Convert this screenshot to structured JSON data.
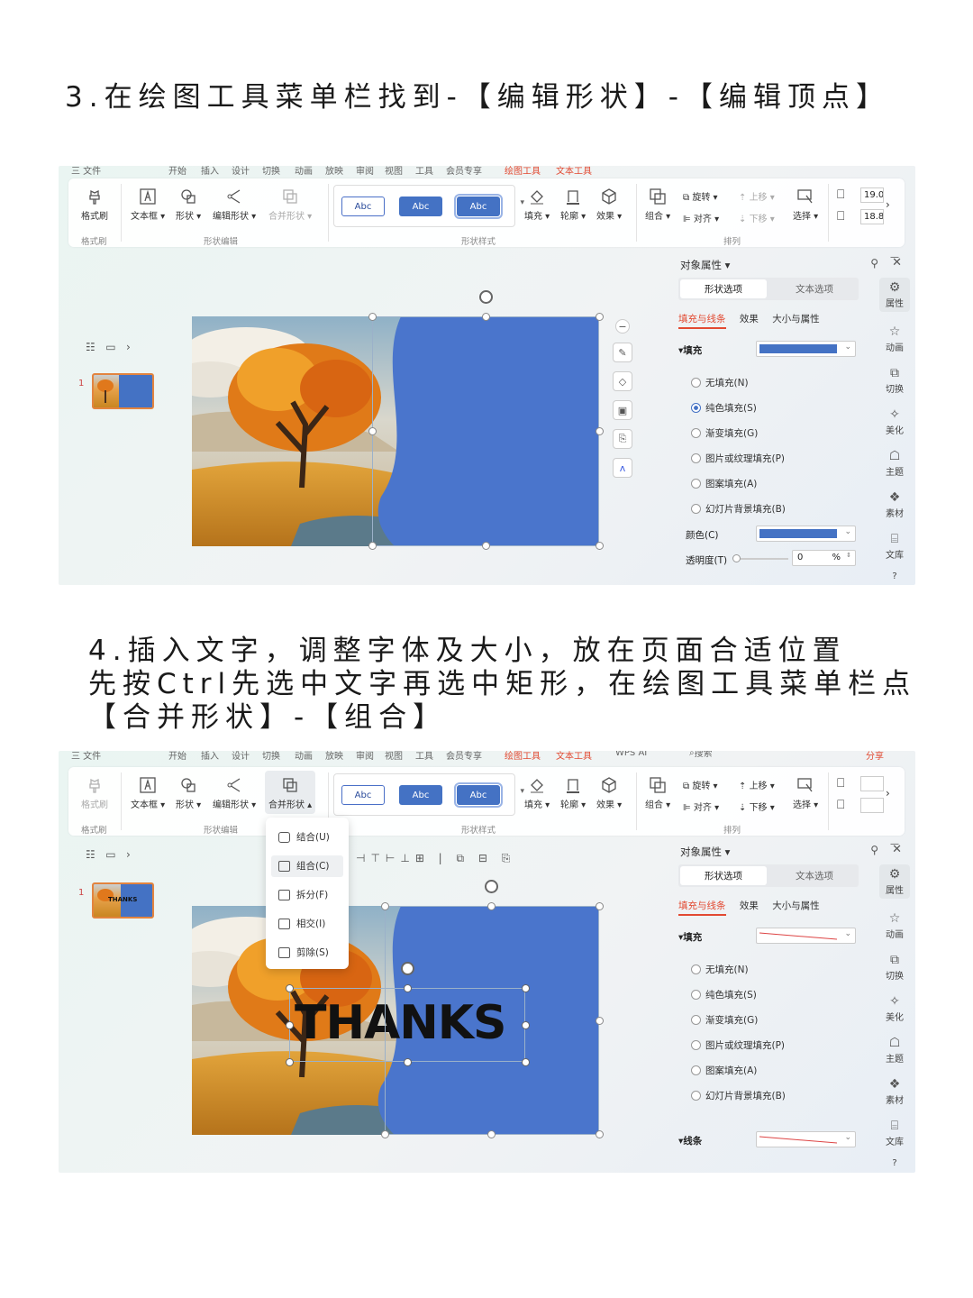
{
  "step3": {
    "heading": "3.在绘图工具菜单栏找到-【编辑形状】-【编辑顶点】"
  },
  "step4": {
    "heading_line1": "4.插入文字，调整字体及大小，放在页面合适位置",
    "heading_line2": "先按Ctrl先选中文字再选中矩形，在绘图工具菜单栏点",
    "heading_line3": "【合并形状】-【组合】"
  },
  "menubar": {
    "items": [
      "开始",
      "插入",
      "设计",
      "切换",
      "动画",
      "放映",
      "审阅",
      "视图",
      "工具",
      "会员专享",
      "绘图工具",
      "文本工具",
      "WPS AI"
    ],
    "active": "绘图工具",
    "search": "搜索",
    "share": "分享",
    "file": "三 文件"
  },
  "ribbon": {
    "format_painter": "格式刷",
    "textbox": "文本框",
    "shape": "形状",
    "edit_shape": "编辑形状",
    "merge_shape": "合并形状",
    "group_format": "格式刷",
    "group_edit": "形状编辑",
    "style_btn": "Abc",
    "fill": "填充",
    "outline": "轮廓",
    "effect": "效果",
    "group_style": "形状样式",
    "combine": "组合",
    "rotate": "旋转",
    "align": "对齐",
    "up": "上移",
    "down": "下移",
    "select": "选择",
    "group_arrange": "排列",
    "width": "19.0",
    "height": "18.8"
  },
  "panel": {
    "title": "对象属性",
    "tab_shape": "形状选项",
    "tab_text": "文本选项",
    "sub_fill": "填充与线条",
    "sub_effect": "效果",
    "sub_size": "大小与属性",
    "fill_section": "填充",
    "opt_none": "无填充(N)",
    "opt_solid": "纯色填充(S)",
    "opt_gradient": "渐变填充(G)",
    "opt_picture": "图片或纹理填充(P)",
    "opt_pattern": "图案填充(A)",
    "opt_slide": "幻灯片背景填充(B)",
    "color_label": "颜色(C)",
    "transparency_label": "透明度(T)",
    "transparency_value": "0",
    "transparency_unit": "%",
    "line_section": "线条",
    "fill_color": "#4472c4"
  },
  "rightbar": [
    "属性",
    "动画",
    "切换",
    "美化",
    "主题",
    "素材",
    "文库"
  ],
  "merge_menu": {
    "items": [
      "结合(U)",
      "组合(C)",
      "拆分(F)",
      "相交(I)",
      "剪除(S)"
    ],
    "hover": "组合(C)"
  },
  "slide_text": "THANKS",
  "thumb_text": "THANKS"
}
